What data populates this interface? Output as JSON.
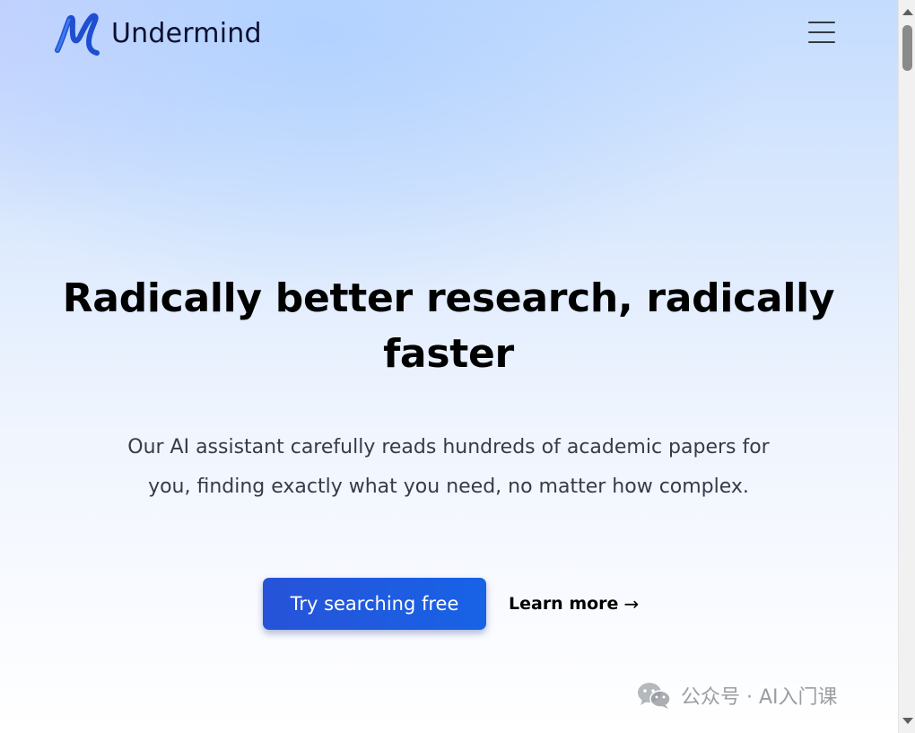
{
  "header": {
    "brand_name": "Undermind",
    "logo_icon": "undermind-u-logo-icon",
    "menu_icon": "hamburger-menu-icon"
  },
  "hero": {
    "title": "Radically better research, radically faster",
    "subtitle": "Our AI assistant carefully reads hundreds of academic papers for you, finding exactly what you need, no matter how complex.",
    "primary_cta": "Try searching free",
    "secondary_cta": "Learn more",
    "secondary_cta_arrow": "→"
  },
  "watermark": {
    "text": "公众号 · AI入门课",
    "icon": "wechat-icon"
  },
  "colors": {
    "primary_button": "#2058de",
    "title_text": "#000000",
    "body_text": "#353c48",
    "brand_text": "#0d1030",
    "logo_blue": "#1f4fd0"
  }
}
